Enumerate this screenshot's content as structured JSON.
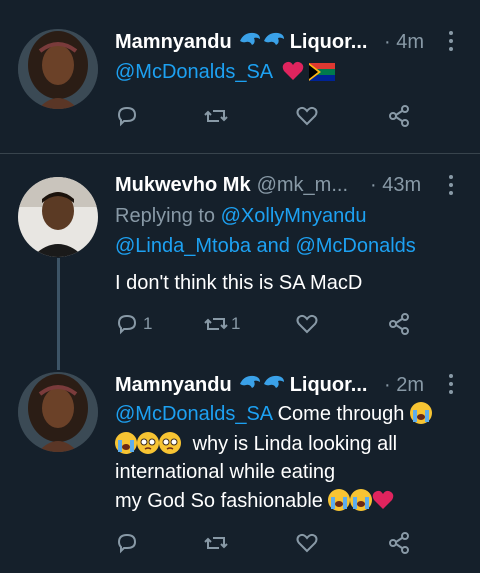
{
  "tweets": [
    {
      "author_name": "Mamnyandu",
      "author_name_suffix": "Liquor...",
      "time": "· 4m",
      "text_mention": "@McDonalds_SA",
      "reply_count": "",
      "retweet_count": "",
      "icons": [
        "dolphin-emoji",
        "dolphin-emoji",
        "red-heart-emoji",
        "south-africa-flag-emoji"
      ]
    },
    {
      "author_name": "Mukwevho Mk",
      "handle": "@mk_m...",
      "time": "· 43m",
      "replying_to_label": "Replying to",
      "replying_to_1": "@XollyMnyandu",
      "replying_to_2": "@Linda_Mtoba",
      "and_label": "and",
      "replying_to_3": "@McDonalds",
      "text": "I don't think this is SA MacD",
      "reply_count": "1",
      "retweet_count": "1"
    },
    {
      "author_name": "Mamnyandu",
      "author_name_suffix": "Liquor...",
      "time": "· 2m",
      "text_mention": "@McDonalds_SA",
      "text_1": "Come through",
      "text_2": "why is Linda looking all",
      "text_3": "international while eating",
      "text_4": "my God So fashionable",
      "reply_count": "",
      "retweet_count": ""
    }
  ],
  "colors": {
    "background": "#15202b",
    "link": "#1da1f2",
    "muted": "#8899a6",
    "separator": "#38444d",
    "thread_line": "#3d5466"
  }
}
